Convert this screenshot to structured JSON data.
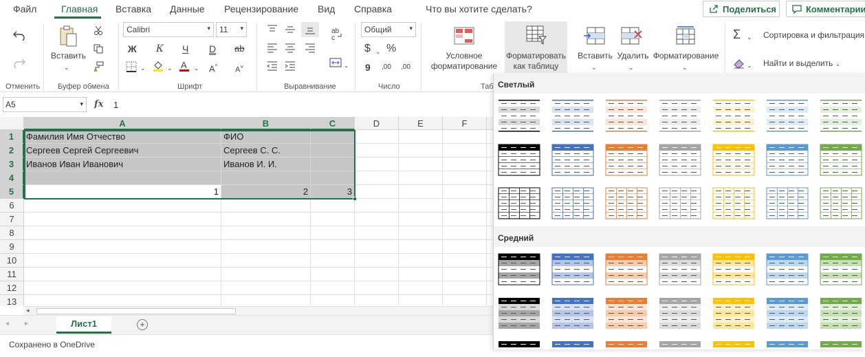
{
  "menu": {
    "tabs": [
      "Файл",
      "Главная",
      "Вставка",
      "Данные",
      "Рецензирование",
      "Вид",
      "Справка"
    ],
    "tell_me": "Что вы хотите сделать?",
    "share": "Поделиться",
    "comments": "Комментарии"
  },
  "ribbon": {
    "undo_group": "Отменить",
    "clipboard_group": "Буфер обмена",
    "paste": "Вставить",
    "font_group": "Шрифт",
    "font_name": "Calibri",
    "font_size": "11",
    "bold": "Ж",
    "italic": "К",
    "underline": "Ч",
    "double_underline": "D",
    "strike": "ab",
    "align_group": "Выравнивание",
    "number_group": "Число",
    "number_format": "Общий",
    "currency": "$",
    "percent": "%",
    "comma": "9",
    "inc_dec": ",00",
    "dec_dec": ",00",
    "styles_group": "Таб",
    "cond_format_1": "Условное",
    "cond_format_2": "форматирование",
    "format_table_1": "Форматировать",
    "format_table_2": "как таблицу",
    "insert": "Вставить",
    "delete": "Удалить",
    "format": "Форматирование",
    "sort_filter": "Сортировка и фильтрация",
    "find_select": "Найти и выделить"
  },
  "formula_bar": {
    "name_box": "A5",
    "fx": "fx",
    "value": "1"
  },
  "grid": {
    "columns": [
      "A",
      "B",
      "C",
      "D",
      "E",
      "F"
    ],
    "rows": [
      "1",
      "2",
      "3",
      "4",
      "5",
      "6",
      "7",
      "8",
      "9",
      "10",
      "11",
      "12",
      "13"
    ],
    "cells": {
      "A1": "Фамилия Имя Отчество",
      "B1": "ФИО",
      "A2": "Сергеев Сергей Сергеевич",
      "B2": "Сергеев С. С.",
      "A3": "Иванов Иван Иванович",
      "B3": "Иванов И. И.",
      "A5": "1",
      "B5": "2",
      "C5": "3"
    }
  },
  "sheets": {
    "active": "Лист1"
  },
  "status": {
    "saved": "Сохранено в OneDrive"
  },
  "gallery": {
    "light_title": "Светлый",
    "medium_title": "Средний",
    "palette": [
      "#000000",
      "#4472c4",
      "#ed7d31",
      "#a5a5a5",
      "#ffc000",
      "#5b9bd5",
      "#70ad47"
    ],
    "light_tints": [
      "#d9d9d9",
      "#d9e1f2",
      "#fce4d6",
      "#ededed",
      "#fff2cc",
      "#ddebf7",
      "#e2efda"
    ],
    "medium_tints": [
      "#a6a6a6",
      "#b4c6e7",
      "#f8cbad",
      "#dbdbdb",
      "#ffe699",
      "#bdd7ee",
      "#c6e0b4"
    ]
  }
}
